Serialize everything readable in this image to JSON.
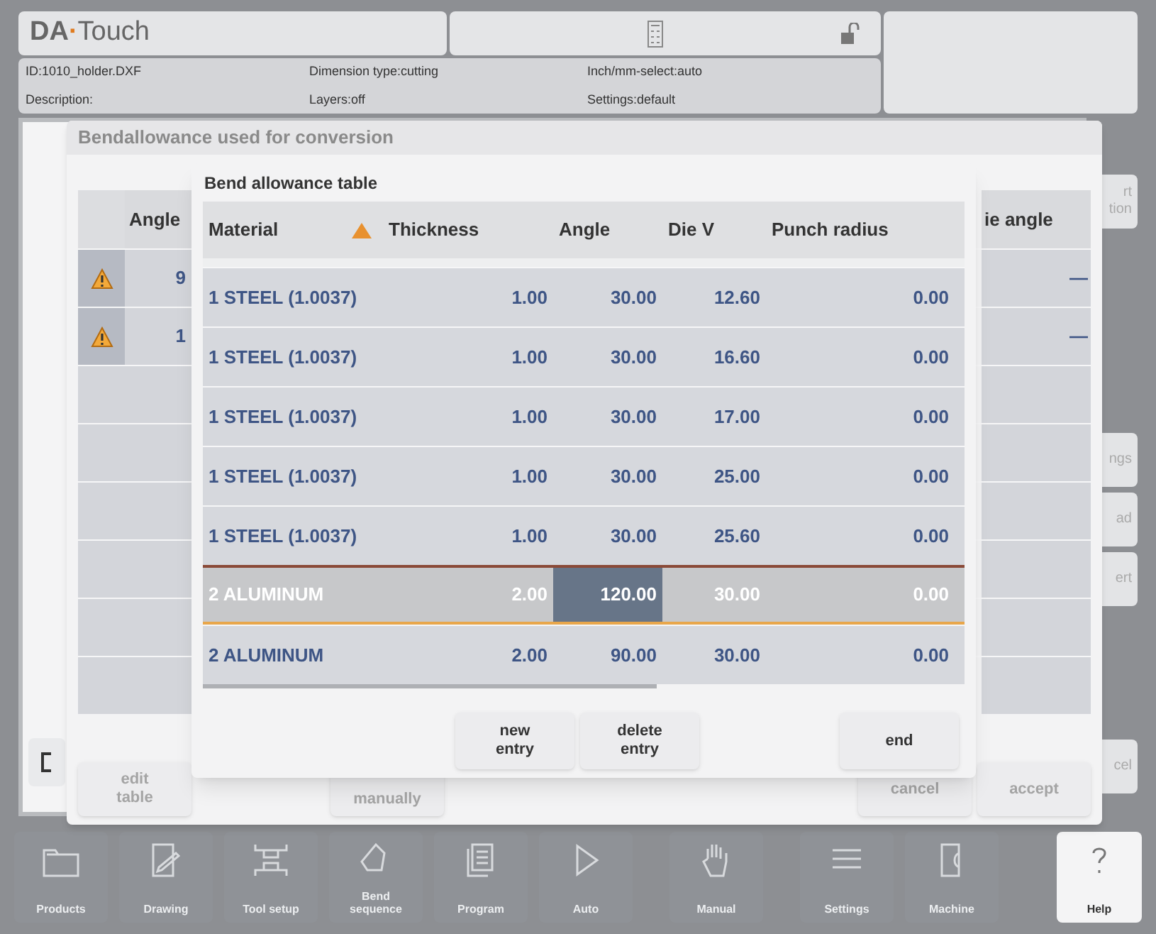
{
  "header": {
    "logo": {
      "brand": "DA",
      "dot": "·",
      "product": "Touch"
    },
    "info": [
      {
        "label": "ID:1010_holder.DXF"
      },
      {
        "label": "Dimension type:cutting"
      },
      {
        "label": "Inch/mm-select:auto"
      },
      {
        "label": "Description:"
      },
      {
        "label": "Layers:off"
      },
      {
        "label": "Settings:default"
      }
    ]
  },
  "side_buttons": [
    {
      "label": "rt\ntion"
    },
    {
      "label": "ngs"
    },
    {
      "label": "ad"
    },
    {
      "label": "ert"
    },
    {
      "label": "cel"
    }
  ],
  "conversion_dialog": {
    "title": "Bendallowance used for conversion",
    "columns": [
      "Angle",
      "ie angle"
    ],
    "rows": [
      {
        "warning": true,
        "angle": "9",
        "die_angle": "—"
      },
      {
        "warning": true,
        "angle": "1",
        "die_angle": "—"
      },
      {
        "warning": false
      },
      {
        "warning": false
      },
      {
        "warning": false
      },
      {
        "warning": false
      },
      {
        "warning": false
      },
      {
        "warning": false
      }
    ],
    "buttons": [
      {
        "label": "edit\ntable",
        "disabled": true
      },
      {
        "label": "manually",
        "disabled": true
      },
      {
        "label": "cancel",
        "disabled": true
      },
      {
        "label": "accept",
        "disabled": true
      }
    ]
  },
  "bend_table": {
    "title": "Bend allowance table",
    "columns": [
      {
        "label": "Material",
        "sorted": true
      },
      {
        "label": "Thickness",
        "sorted": false
      },
      {
        "label": "Angle",
        "sorted": false
      },
      {
        "label": "Die V",
        "sorted": false
      },
      {
        "label": "Punch radius",
        "sorted": false
      }
    ],
    "rows": [
      {
        "cells": [
          "1 STEEL (1.0037)",
          "1.00",
          "30.00",
          "12.60",
          "0.00"
        ],
        "selected": false
      },
      {
        "cells": [
          "1 STEEL (1.0037)",
          "1.00",
          "30.00",
          "16.60",
          "0.00"
        ],
        "selected": false
      },
      {
        "cells": [
          "1 STEEL (1.0037)",
          "1.00",
          "30.00",
          "17.00",
          "0.00"
        ],
        "selected": false
      },
      {
        "cells": [
          "1 STEEL (1.0037)",
          "1.00",
          "30.00",
          "25.00",
          "0.00"
        ],
        "selected": false
      },
      {
        "cells": [
          "1 STEEL (1.0037)",
          "1.00",
          "30.00",
          "25.60",
          "0.00"
        ],
        "selected": false
      },
      {
        "cells": [
          "2 ALUMINUM",
          "2.00",
          "120.00",
          "30.00",
          "0.00"
        ],
        "selected": true,
        "active_cells": [
          false,
          false,
          true,
          false,
          false
        ]
      },
      {
        "cells": [
          "2 ALUMINUM",
          "2.00",
          "90.00",
          "30.00",
          "0.00"
        ],
        "selected": false
      }
    ],
    "buttons": [
      "new\nentry",
      "delete\nentry",
      "end"
    ]
  },
  "nav": [
    {
      "label": "Products",
      "kind": "nav"
    },
    {
      "label": "Drawing",
      "kind": "nav"
    },
    {
      "label": "Tool setup",
      "kind": "nav"
    },
    {
      "label": "Bend\nsequence",
      "kind": "nav"
    },
    {
      "label": "Program",
      "kind": "nav"
    },
    {
      "label": "Auto",
      "kind": "nav"
    },
    {
      "label": "Manual",
      "kind": "nav"
    },
    {
      "label": "Settings",
      "kind": "nav"
    },
    {
      "label": "Machine",
      "kind": "nav"
    },
    {
      "label": "Help",
      "kind": "help"
    }
  ]
}
